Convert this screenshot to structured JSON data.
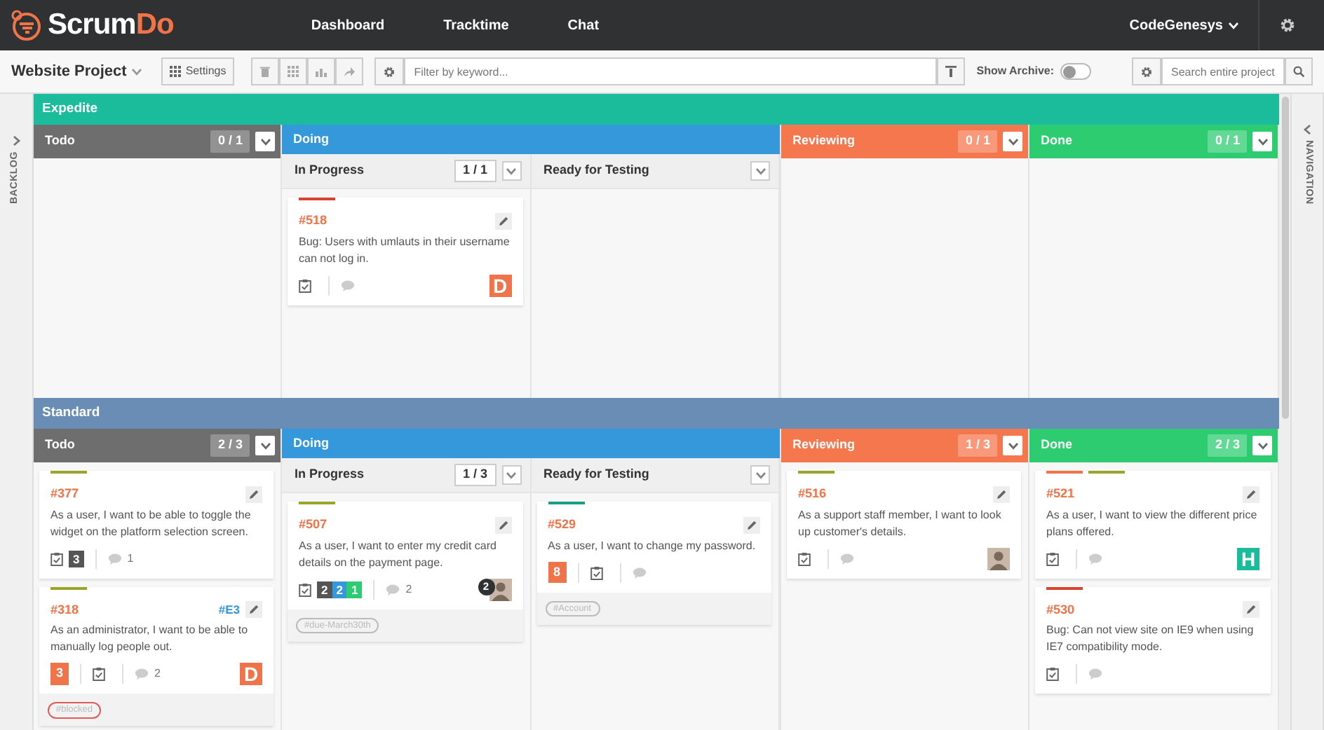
{
  "nav": {
    "logo": "ScrumDo",
    "links": [
      "Dashboard",
      "Tracktime",
      "Chat"
    ],
    "user": "CodeGenesys"
  },
  "toolbar": {
    "project": "Website Project",
    "settings": "Settings",
    "filter_placeholder": "Filter by keyword...",
    "archive_label": "Show Archive:",
    "archive_on": false,
    "search_placeholder": "Search entire project"
  },
  "sidebars": {
    "left": "BACKLOG",
    "right": "NAVIGATION"
  },
  "lanes": [
    {
      "title": "Expedite",
      "color": "#1abc9c",
      "columns": [
        {
          "title": "Todo",
          "color": "#6e6e6e",
          "count": "0 / 1"
        },
        {
          "title": "Doing",
          "color": "#3498db",
          "subcolumns": [
            {
              "title": "In Progress",
              "count": "1 / 1",
              "cards": [
                {
                  "number": "#518",
                  "text": "Bug: Users with umlauts in their username can not log in.",
                  "labels": [
                    {
                      "color": "#d9432f"
                    }
                  ],
                  "avatar": {
                    "kind": "letter",
                    "letter": "D",
                    "color": "#f0744a"
                  }
                }
              ]
            },
            {
              "title": "Ready for Testing"
            }
          ]
        },
        {
          "title": "Reviewing",
          "color": "#f4774e",
          "count": "0 / 1"
        },
        {
          "title": "Done",
          "color": "#2ecc71",
          "count": "0 / 1"
        }
      ]
    },
    {
      "title": "Standard",
      "color": "#6a8db5",
      "columns": [
        {
          "title": "Todo",
          "color": "#6e6e6e",
          "count": "2 / 3",
          "cards": [
            {
              "number": "#377",
              "text": "As a user, I want to be able to toggle the widget on the platform selection screen.",
              "labels": [
                {
                  "color": "#9aa52a"
                }
              ],
              "tasks": [
                {
                  "count": "3",
                  "color": "#555555"
                }
              ],
              "comments": "1"
            },
            {
              "number": "#318",
              "epic": "#E3",
              "text": "As an administrator, I want to be able to manually log people out.",
              "labels": [
                {
                  "color": "#9aa52a"
                }
              ],
              "points": "3",
              "comments": "2",
              "avatar": {
                "kind": "letter",
                "letter": "D",
                "color": "#f0744a"
              },
              "tags": [
                {
                  "text": "#blocked",
                  "color": "#e05a5a"
                }
              ]
            }
          ]
        },
        {
          "title": "Doing",
          "color": "#3498db",
          "subcolumns": [
            {
              "title": "In Progress",
              "count": "1 / 3",
              "cards": [
                {
                  "number": "#507",
                  "text": "As a user, I want to enter my credit card details on the payment page.",
                  "labels": [
                    {
                      "color": "#9aa52a"
                    }
                  ],
                  "tasks": [
                    {
                      "count": "2",
                      "color": "#555555"
                    },
                    {
                      "count": "2",
                      "color": "#3498db"
                    },
                    {
                      "count": "1",
                      "color": "#2ecc71"
                    }
                  ],
                  "comments": "2",
                  "avatar": {
                    "kind": "photo",
                    "badge": "2"
                  },
                  "tags": [
                    {
                      "text": "#due-March30th",
                      "color": "#bbbbbb"
                    }
                  ]
                }
              ]
            },
            {
              "title": "Ready for Testing",
              "cards": [
                {
                  "number": "#529",
                  "text": "As a user, I want to change my password.",
                  "labels": [
                    {
                      "color": "#16a085"
                    }
                  ],
                  "points": "8",
                  "tags": [
                    {
                      "text": "#Account",
                      "color": "#bbbbbb"
                    }
                  ]
                }
              ]
            }
          ]
        },
        {
          "title": "Reviewing",
          "color": "#f4774e",
          "count": "1 / 3",
          "cards": [
            {
              "number": "#516",
              "text": "As a support staff member, I want to look up customer's details.",
              "labels": [
                {
                  "color": "#9aa52a"
                }
              ],
              "avatar": {
                "kind": "photo"
              }
            }
          ]
        },
        {
          "title": "Done",
          "color": "#2ecc71",
          "count": "2 / 3",
          "cards": [
            {
              "number": "#521",
              "text": "As a user, I want to view the different price plans offered.",
              "labels": [
                {
                  "color": "#f0744a"
                },
                {
                  "color": "#9aa52a"
                }
              ],
              "avatar": {
                "kind": "letter",
                "letter": "H",
                "color": "#1abc9c"
              }
            },
            {
              "number": "#530",
              "text": "Bug: Can not view site on IE9 when using IE7 compatibility mode.",
              "labels": [
                {
                  "color": "#d9432f"
                }
              ]
            }
          ]
        }
      ]
    }
  ]
}
